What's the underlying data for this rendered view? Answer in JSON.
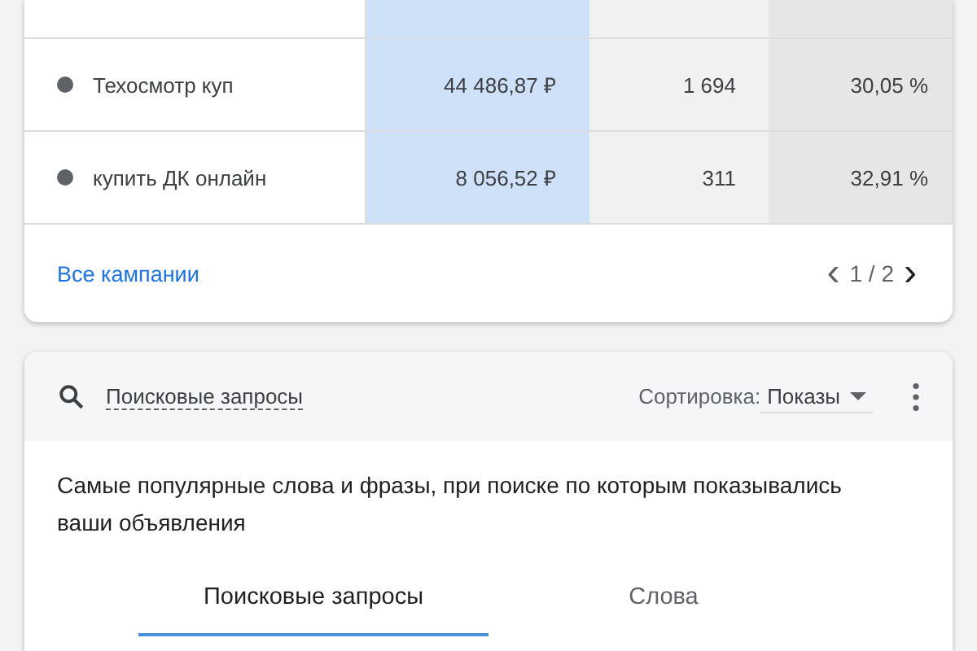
{
  "campaigns": {
    "rows": [
      {
        "name": "Техосмотр куп",
        "cost": "44 486,87 ₽",
        "count": "1 694",
        "share": "30,05 %"
      },
      {
        "name": "купить ДК онлайн",
        "cost": "8 056,52 ₽",
        "count": "311",
        "share": "32,91 %"
      }
    ],
    "all_link": "Все кампании",
    "pager": {
      "prev": "‹",
      "page": "1 / 2",
      "next": "›"
    }
  },
  "search_terms": {
    "title": "Поисковые запросы",
    "sort_label": "Сортировка:",
    "sort_value": "Показы",
    "description": "Самые популярные слова и фразы, при поиске по которым показывались ваши объявления",
    "tabs": [
      {
        "label": "Поисковые запросы",
        "selected": true
      },
      {
        "label": "Слова",
        "selected": false
      }
    ]
  }
}
